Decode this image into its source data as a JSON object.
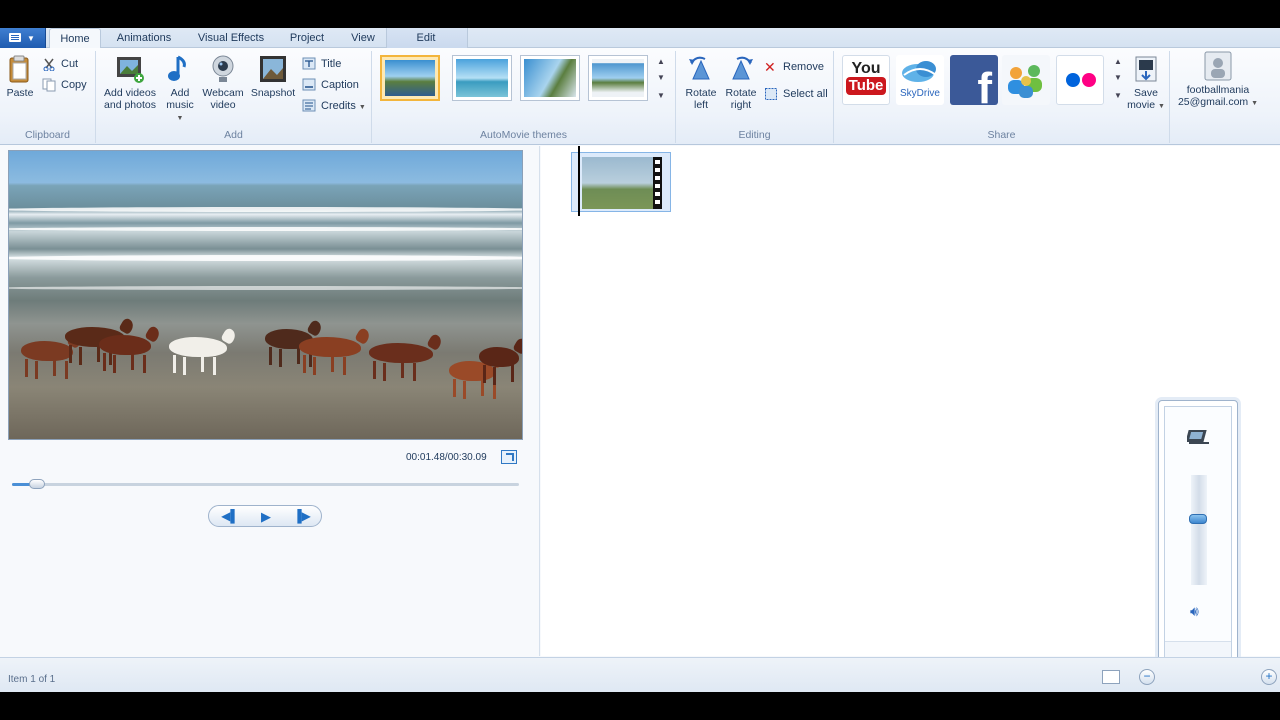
{
  "tabs": [
    {
      "label": "Home",
      "active": true
    },
    {
      "label": "Animations"
    },
    {
      "label": "Visual Effects"
    },
    {
      "label": "Project"
    },
    {
      "label": "View"
    },
    {
      "label": "Edit"
    }
  ],
  "ribbon": {
    "clipboard": {
      "paste": "Paste",
      "cut": "Cut",
      "copy": "Copy",
      "group_label": "Clipboard"
    },
    "add": {
      "add_videos_line1": "Add videos",
      "add_videos_line2": "and photos",
      "add_music_line1": "Add",
      "add_music_line2": "music",
      "webcam_line1": "Webcam",
      "webcam_line2": "video",
      "snapshot": "Snapshot",
      "title": "Title",
      "caption": "Caption",
      "credits": "Credits",
      "group_label": "Add"
    },
    "themes": {
      "group_label": "AutoMovie themes",
      "selected_index": 0
    },
    "editing": {
      "rotate_left_line1": "Rotate",
      "rotate_left_line2": "left",
      "rotate_right_line1": "Rotate",
      "rotate_right_line2": "right",
      "remove": "Remove",
      "select_all": "Select all",
      "group_label": "Editing"
    },
    "share": {
      "youtube_line1": "You",
      "youtube_line2": "Tube",
      "skydrive": "SkyDrive",
      "facebook": "f",
      "save_line1": "Save",
      "save_line2": "movie",
      "group_label": "Share"
    },
    "account": {
      "line1": "footballmania",
      "line2": "25@gmail.com"
    }
  },
  "preview": {
    "time": "00:01.48/00:30.09",
    "progress": 0.049
  },
  "mixer": {
    "label": "Mixer",
    "level": 0.6
  },
  "status": {
    "text": "Item 1 of 1"
  },
  "colors": {
    "accent": "#2a66bd",
    "selected_theme": "#f3b53c",
    "facebook": "#3b5998",
    "youtube_red": "#cc181e"
  }
}
